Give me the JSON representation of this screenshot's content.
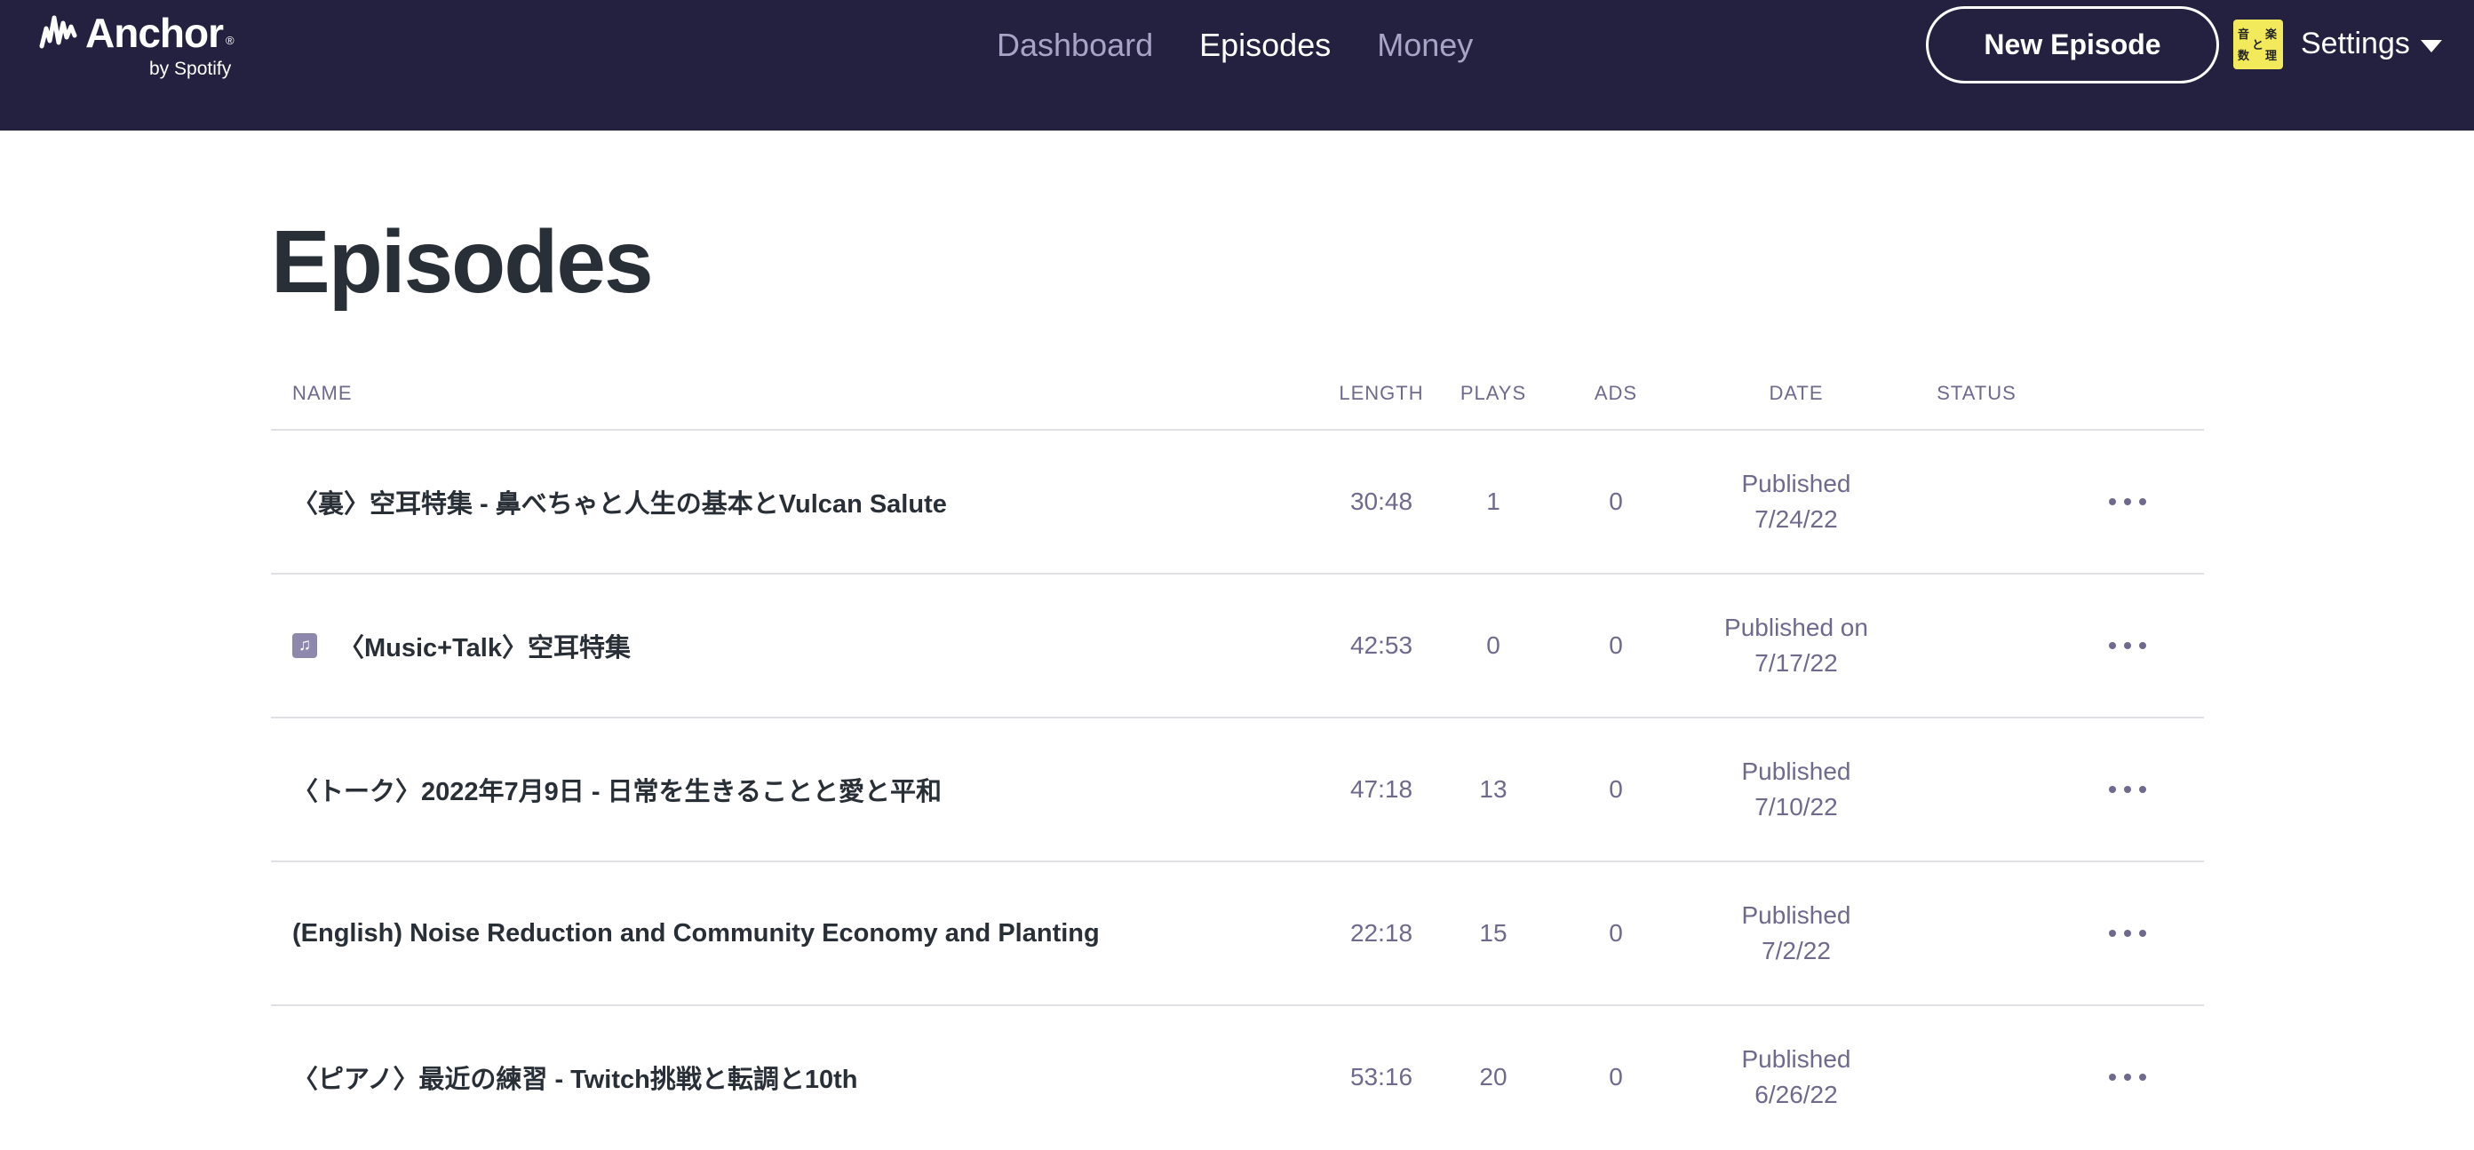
{
  "brand": {
    "name": "Anchor",
    "sub": "by Spotify",
    "reg": "®"
  },
  "nav": [
    {
      "label": "Dashboard",
      "active": false
    },
    {
      "label": "Episodes",
      "active": true
    },
    {
      "label": "Money",
      "active": false
    }
  ],
  "header": {
    "new_episode_label": "New Episode",
    "avatar_glyphs": [
      "音",
      "楽",
      "数",
      "と",
      "理"
    ],
    "settings_label": "Settings"
  },
  "page": {
    "title": "Episodes"
  },
  "table": {
    "columns": {
      "name": "NAME",
      "length": "LENGTH",
      "plays": "PLAYS",
      "ads": "ADS",
      "date": "DATE",
      "status": "STATUS"
    },
    "rows": [
      {
        "name": "〈裏〉空耳特集 - 鼻べちゃと人生の基本とVulcan Salute",
        "music": false,
        "length": "30:48",
        "plays": "1",
        "ads": "0",
        "date_line1": "Published",
        "date_line2": "7/24/22"
      },
      {
        "name": "〈Music+Talk〉空耳特集",
        "music": true,
        "length": "42:53",
        "plays": "0",
        "ads": "0",
        "date_line1": "Published on",
        "date_line2": "7/17/22"
      },
      {
        "name": "〈トーク〉2022年7月9日 - 日常を生きることと愛と平和",
        "music": false,
        "length": "47:18",
        "plays": "13",
        "ads": "0",
        "date_line1": "Published",
        "date_line2": "7/10/22"
      },
      {
        "name": "(English) Noise Reduction and Community Economy and Planting",
        "music": false,
        "length": "22:18",
        "plays": "15",
        "ads": "0",
        "date_line1": "Published",
        "date_line2": "7/2/22"
      },
      {
        "name": "〈ピアノ〉最近の練習 - Twitch挑戦と転調と10th",
        "music": false,
        "length": "53:16",
        "plays": "20",
        "ads": "0",
        "date_line1": "Published",
        "date_line2": "6/26/22"
      }
    ]
  },
  "colors": {
    "topbar": "#24203f",
    "nav_inactive": "#a9a3c7",
    "muted_text": "#6f6a8d",
    "avatar_bg": "#f3ea5b"
  }
}
